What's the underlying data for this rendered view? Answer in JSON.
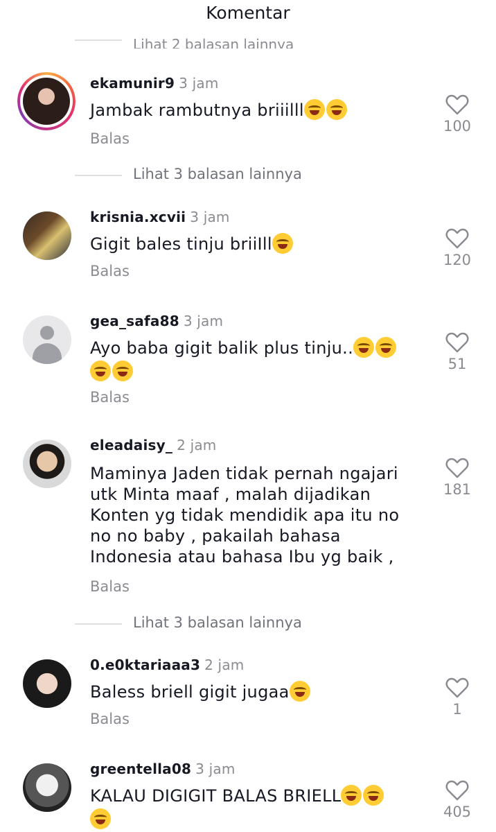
{
  "header": {
    "title": "Komentar"
  },
  "top_partial_replies": "Lihat 2 balasan lainnya",
  "reply_label": "Balas",
  "comments": [
    {
      "username": "ekamunir9",
      "time": "3 jam",
      "text": "Jambak rambutnya briiilll",
      "emoji_count": 2,
      "likes": "100"
    },
    {
      "username": "krisnia.xcvii",
      "time": "3 jam",
      "text": "Gigit bales tinju briiIll",
      "emoji_count": 1,
      "likes": "120"
    },
    {
      "username": "gea_safa88",
      "time": "3 jam",
      "text": "Ayo baba gigit balik plus tinju..",
      "likes": "51"
    },
    {
      "username": "eleadaisy_",
      "time": "2 jam",
      "lines": [
        "Maminya Jaden tidak pernah ngajari",
        "utk Minta maaf , malah dijadikan",
        "Konten yg tidak mendidik apa itu no",
        "no no baby ,  pakailah bahasa",
        "Indonesia atau bahasa Ibu yg baik ,"
      ],
      "likes": "181"
    },
    {
      "username": "0.e0ktariaaa3",
      "time": "2 jam",
      "text": "Baless briell gigit jugaa",
      "likes": "1"
    },
    {
      "username": "greentella08",
      "time": "3 jam",
      "text": "KALAU DIGIGIT BALAS BRIELL",
      "likes": "405"
    }
  ],
  "more_replies": [
    {
      "label": "Lihat 3 balasan lainnya"
    },
    {
      "label": "Lihat 3 balasan lainnya"
    }
  ],
  "icons": {
    "like": "heart-outline-icon",
    "emoji": "tears-of-joy-emoji"
  },
  "colors": {
    "primary_text": "#161823",
    "secondary_text": "#8a8b91",
    "divider": "#dfe0e3"
  }
}
